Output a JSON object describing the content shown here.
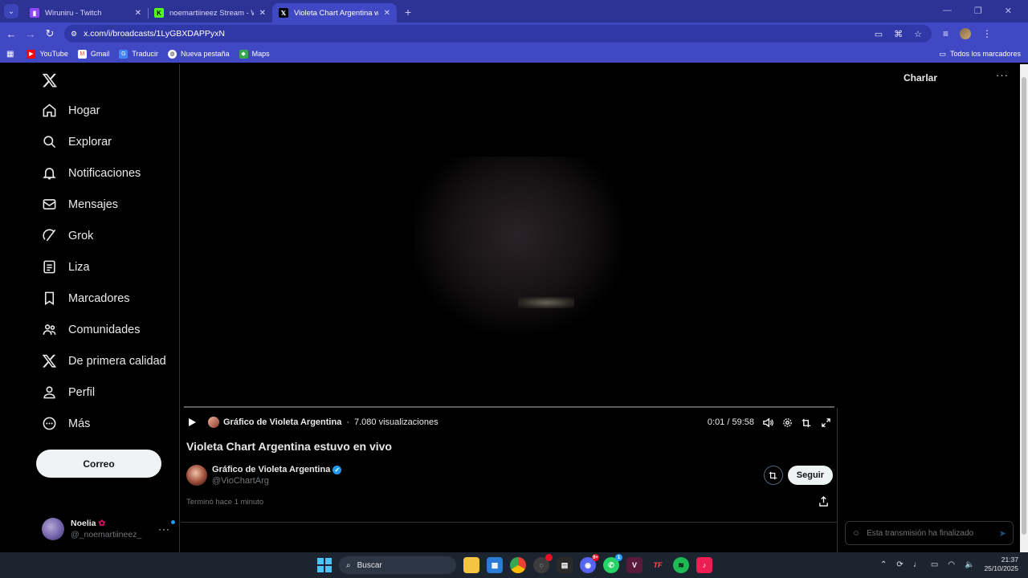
{
  "browser": {
    "tabs": [
      {
        "title": "Wiruniru - Twitch",
        "favicon": "twitch-icon",
        "color": "#9146ff",
        "active": false
      },
      {
        "title": "noemartiineez Stream - Watch Live on Kick",
        "favicon": "kick-icon",
        "color": "#53fc18",
        "active": false
      },
      {
        "title": "Violeta Chart Argentina was live",
        "favicon": "x-icon",
        "color": "#000000",
        "active": true
      }
    ],
    "url": "x.com/i/broadcasts/1LyGBXDAPPyxN",
    "bookmarks": [
      {
        "label": "YouTube",
        "icon": "youtube-icon"
      },
      {
        "label": "Gmail",
        "icon": "gmail-icon"
      },
      {
        "label": "Traducir",
        "icon": "translate-icon"
      },
      {
        "label": "Nueva pestaña",
        "icon": "globe-icon"
      },
      {
        "label": "Maps",
        "icon": "maps-icon"
      }
    ],
    "all_bookmarks": "Todos los marcadores"
  },
  "nav": {
    "items": [
      {
        "label": "Hogar",
        "icon": "home-icon"
      },
      {
        "label": "Explorar",
        "icon": "search-icon"
      },
      {
        "label": "Notificaciones",
        "icon": "bell-icon"
      },
      {
        "label": "Mensajes",
        "icon": "mail-icon"
      },
      {
        "label": "Grok",
        "icon": "grok-icon"
      },
      {
        "label": "Liza",
        "icon": "list-icon"
      },
      {
        "label": "Marcadores",
        "icon": "bookmark-icon"
      },
      {
        "label": "Comunidades",
        "icon": "communities-icon"
      },
      {
        "label": "De primera calidad",
        "icon": "x-premium-icon"
      },
      {
        "label": "Perfil",
        "icon": "person-icon"
      },
      {
        "label": "Más",
        "icon": "more-circle-icon"
      }
    ],
    "post_button": "Correo",
    "account": {
      "name": "Noelia",
      "handle": "@_noemartiineez_"
    }
  },
  "broadcast": {
    "channel": "Gráfico de Violeta Argentina",
    "views": "7.080 visualizaciones",
    "time": "0:01 / 59:58",
    "progress": 0.0003,
    "title": "Violeta Chart Argentina estuvo en vivo",
    "user": {
      "name": "Gráfico de Violeta Argentina",
      "handle": "@VioChartArg",
      "verified": true
    },
    "follow": "Seguir",
    "ended": "Terminó hace 1 minuto"
  },
  "chat": {
    "title": "Charlar",
    "placeholder": "Esta transmisión ha finalizado"
  },
  "taskbar": {
    "search": "Buscar",
    "time": "21:37",
    "date": "25/10/2025",
    "apps": [
      {
        "name": "file-explorer",
        "color": "#f4c443"
      },
      {
        "name": "microsoft-store",
        "color": "#2b7bd8"
      },
      {
        "name": "chrome",
        "color": "#e94235"
      },
      {
        "name": "obs",
        "color": "#3c3c3c"
      },
      {
        "name": "terminal",
        "color": "#2a2a2a"
      },
      {
        "name": "discord",
        "color": "#5865f2",
        "badge": "9+"
      },
      {
        "name": "whatsapp",
        "color": "#25d366",
        "badge": "1"
      },
      {
        "name": "vegas",
        "color": "#5a1b3a"
      },
      {
        "name": "tf-app",
        "color": "#1c2430"
      },
      {
        "name": "spotify",
        "color": "#1db954"
      },
      {
        "name": "tiktok",
        "color": "#ee1d52"
      }
    ]
  }
}
